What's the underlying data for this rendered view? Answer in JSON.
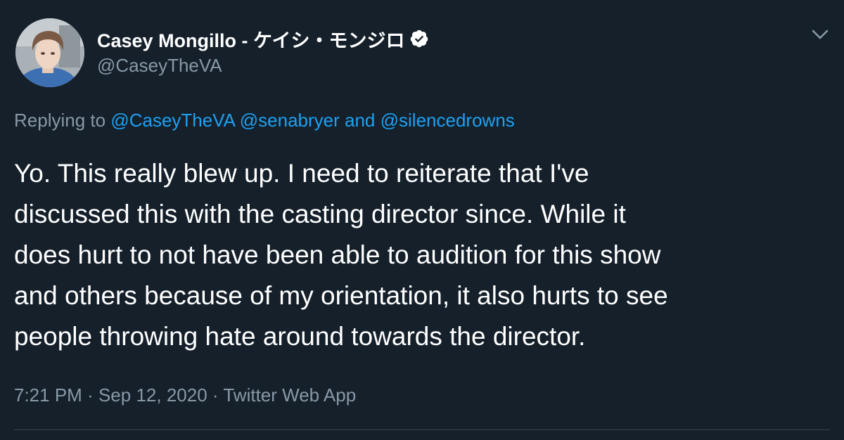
{
  "author": {
    "display_name": "Casey Mongillo - ケイシ・モンジロ",
    "handle": "@CaseyTheVA",
    "verified": true,
    "avatar_icon": "profile-photo"
  },
  "reply": {
    "prefix": "Replying to",
    "mentions": [
      "@CaseyTheVA",
      "@senabryer"
    ],
    "conjunction": "and",
    "last_mention": "@silencedrowns"
  },
  "tweet": {
    "lines": [
      "Yo. This really blew up. I need to reiterate that I've",
      "discussed this with the casting director since. While it",
      "does hurt to not have been able to audition for this show",
      "and others because of my orientation, it also hurts to see",
      "people throwing hate around towards the director."
    ]
  },
  "meta": {
    "time": "7:21 PM",
    "separator": "·",
    "date": "Sep 12, 2020",
    "source": "Twitter Web App"
  },
  "colors": {
    "background": "#15202b",
    "text": "#ffffff",
    "secondary": "#8899a6",
    "link": "#1da1f2",
    "divider": "#38444d"
  }
}
